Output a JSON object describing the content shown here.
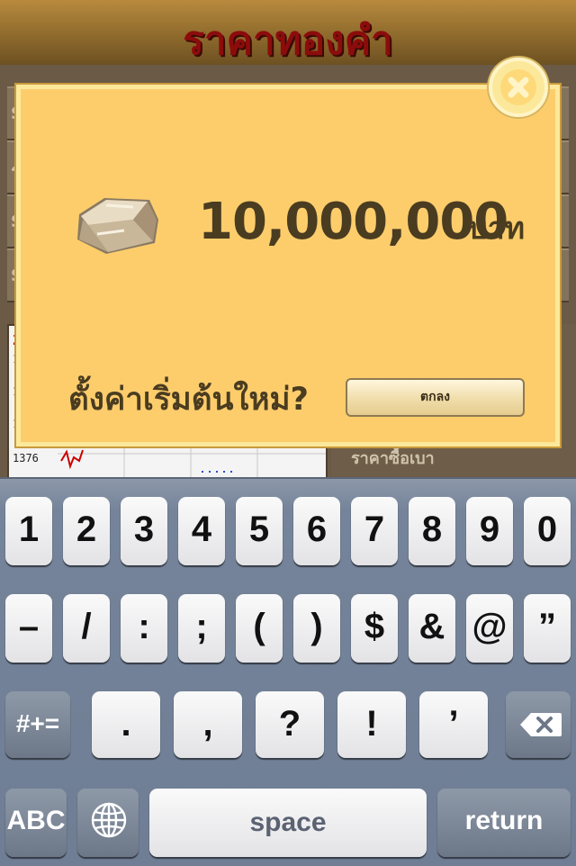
{
  "app": {
    "title": "ราคาทองคำ",
    "bg_row_letters": [
      "s",
      "ร",
      "s",
      "s"
    ],
    "chart_labels": [
      "2",
      "1",
      "1",
      "1",
      "1376"
    ],
    "right_panel_text": "ราคาซื้อเบา"
  },
  "dialog": {
    "amount": "10,000,000",
    "unit": "บาท",
    "question": "ตั้งค่าเริ่มต้นใหม่?",
    "ok_label": "ตกลง",
    "close_icon": "close-x-icon",
    "item_icon": "gold-bar-icon"
  },
  "keyboard": {
    "row1": [
      "1",
      "2",
      "3",
      "4",
      "5",
      "6",
      "7",
      "8",
      "9",
      "0"
    ],
    "row2": [
      "–",
      "/",
      ":",
      ";",
      "(",
      ")",
      "$",
      "&",
      "@",
      "”"
    ],
    "row3": [
      ".",
      ",",
      "?",
      "!",
      "’"
    ],
    "shift_label": "#+=",
    "abc_label": "ABC",
    "space_label": "space",
    "return_label": "return",
    "backspace_icon": "backspace-icon",
    "globe_icon": "globe-icon"
  },
  "colors": {
    "dialog_fill": "#fdcd6c",
    "dialog_border": "#fce89a",
    "title_red": "#8c0c0c",
    "text_brown": "#4a3c20"
  }
}
